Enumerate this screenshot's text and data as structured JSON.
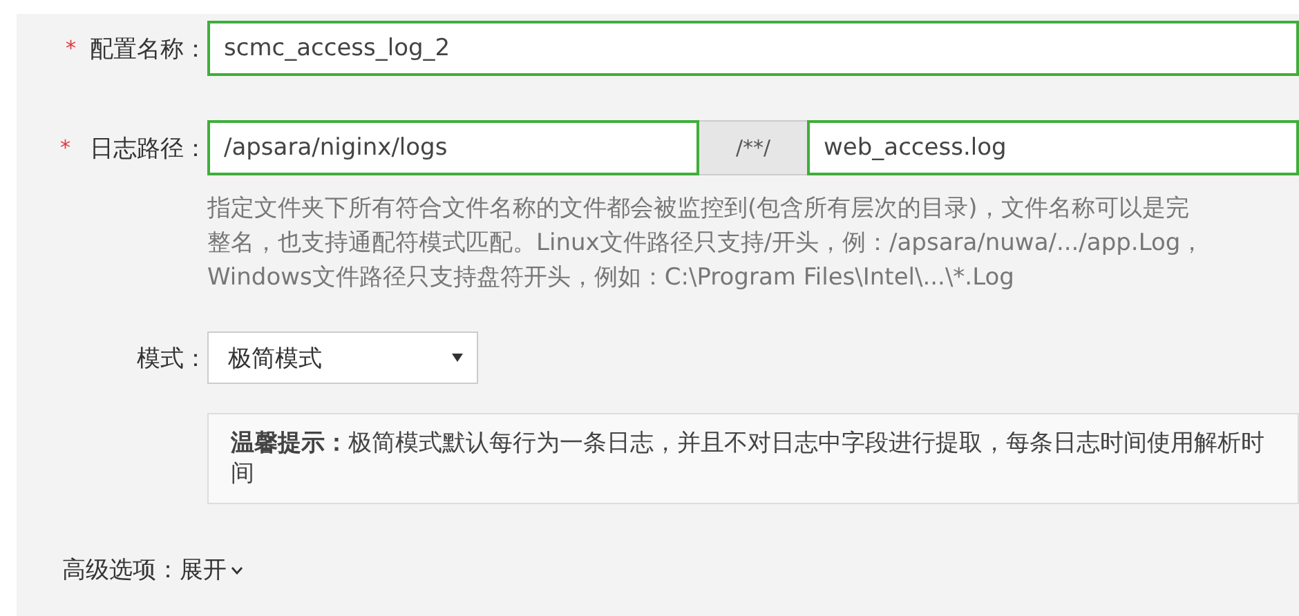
{
  "fields": [
    {
      "label": "配置名称：",
      "required_mark": "*",
      "kind": "text",
      "value": "scmc_access_log_2"
    },
    {
      "label": "日志路径：",
      "required_mark": "*",
      "kind": "path",
      "value": "/apsara/niginx/logs",
      "separator": "/**/",
      "file_value": "web_access.log"
    }
  ],
  "path_hint_lines": [
    "指定文件夹下所有符合文件名称的文件都会被监控到(包含所有层次的目录)，文件名称可以是完",
    "整名，也支持通配符模式匹配。Linux文件路径只支持/开头，例：/apsara/nuwa/.../app.Log，",
    "Windows文件路径只支持盘符开头，例如：C:\\Program Files\\Intel\\...\\*.Log"
  ],
  "mode": {
    "label": "模式：",
    "value": "极简模式"
  },
  "tip": "**温馨提示：**极简模式默认每行为一条日志，并且不对日志中字段进行提取，每条日志时间使用解析时间",
  "advanced": {
    "label": "高级选项：",
    "toggle": "展开",
    "expanded": false
  }
}
